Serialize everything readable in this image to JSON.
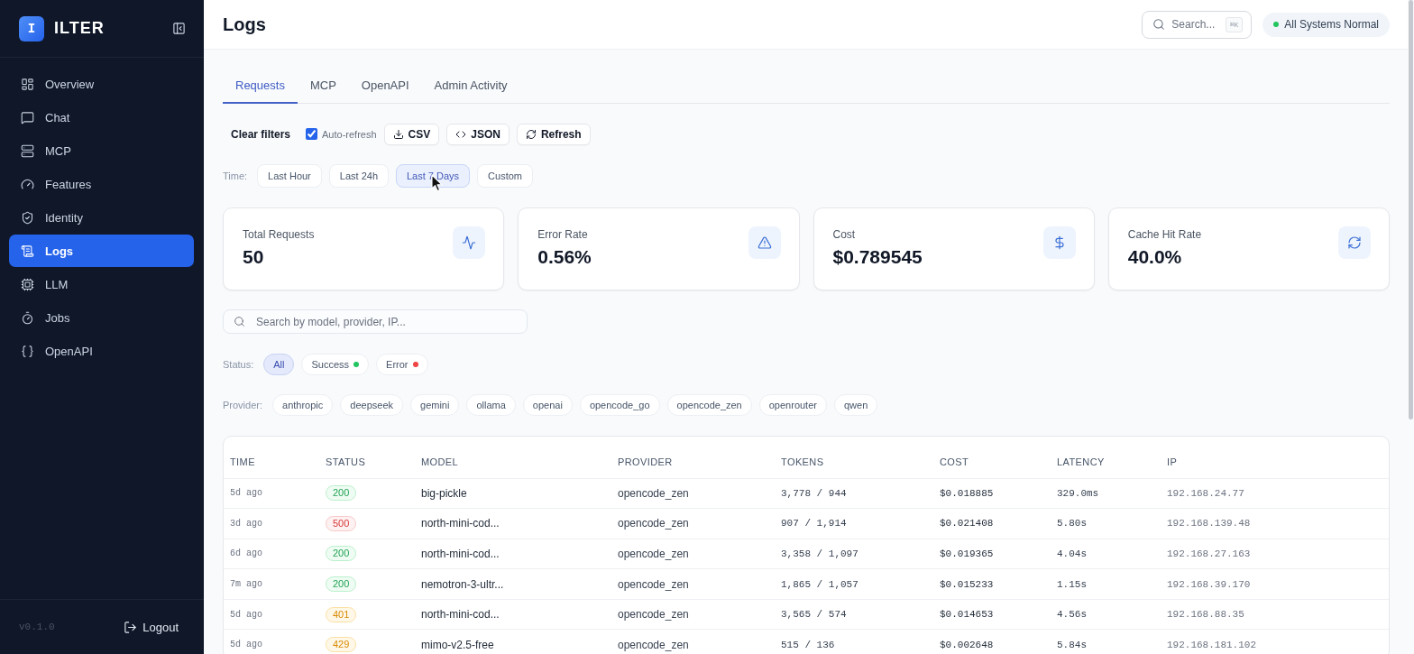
{
  "sidebar": {
    "logo": {
      "letter": "I",
      "name": "ILTER"
    },
    "items": [
      {
        "label": "Overview",
        "selected": false
      },
      {
        "label": "Chat",
        "selected": false
      },
      {
        "label": "MCP",
        "selected": false
      },
      {
        "label": "Features",
        "selected": false
      },
      {
        "label": "Identity",
        "selected": false
      },
      {
        "label": "Logs",
        "selected": true
      },
      {
        "label": "LLM",
        "selected": false
      },
      {
        "label": "Jobs",
        "selected": false
      },
      {
        "label": "OpenAPI",
        "selected": false
      }
    ],
    "version": "v0.1.0",
    "logout": "Logout"
  },
  "header": {
    "title": "Logs",
    "search": {
      "label": "Search...",
      "shortcut": "⌘K"
    },
    "status": "All Systems Normal"
  },
  "tabs": [
    {
      "label": "Requests",
      "selected": true
    },
    {
      "label": "MCP",
      "selected": false
    },
    {
      "label": "OpenAPI",
      "selected": false
    },
    {
      "label": "Admin Activity",
      "selected": false
    }
  ],
  "toolbar": {
    "clear": "Clear filters",
    "auto_refresh": {
      "label": "Auto-refresh",
      "checked": true
    },
    "buttons": [
      "CSV",
      "JSON",
      "Refresh"
    ]
  },
  "time_filter": {
    "label": "Time:",
    "options": [
      {
        "label": "Last Hour",
        "selected": false
      },
      {
        "label": "Last 24h",
        "selected": false
      },
      {
        "label": "Last 7 Days",
        "selected": true
      },
      {
        "label": "Custom",
        "selected": false
      }
    ]
  },
  "stats": [
    {
      "label": "Total Requests",
      "value": "50"
    },
    {
      "label": "Error Rate",
      "value": "0.56%"
    },
    {
      "label": "Cost",
      "value": "$0.789545"
    },
    {
      "label": "Cache Hit Rate",
      "value": "40.0%"
    }
  ],
  "search": {
    "placeholder": "Search by model, provider, IP..."
  },
  "status_filter": {
    "label": "Status:",
    "options": [
      {
        "label": "All",
        "selected": true
      },
      {
        "label": "Success",
        "selected": false,
        "color": "#22c55e"
      },
      {
        "label": "Error",
        "selected": false,
        "color": "#ef4444"
      }
    ]
  },
  "provider_filter": {
    "label": "Provider:",
    "options": [
      {
        "label": "anthropic",
        "selected": false
      },
      {
        "label": "deepseek",
        "selected": false
      },
      {
        "label": "gemini",
        "selected": false
      },
      {
        "label": "ollama",
        "selected": false
      },
      {
        "label": "openai",
        "selected": false
      },
      {
        "label": "opencode_go",
        "selected": false
      },
      {
        "label": "opencode_zen",
        "selected": false
      },
      {
        "label": "openrouter",
        "selected": false
      },
      {
        "label": "qwen",
        "selected": false
      }
    ]
  },
  "table": {
    "columns": [
      "TIME",
      "STATUS",
      "MODEL",
      "PROVIDER",
      "TOKENS",
      "COST",
      "LATENCY",
      "IP"
    ],
    "rows": [
      {
        "time": "5d ago",
        "status": {
          "code": "200",
          "kind": "success"
        },
        "model": "big-pickle",
        "provider": "opencode_zen",
        "tokens": "3,778 / 944",
        "cost": "$0.018885",
        "latency": "329.0ms",
        "ip": "192.168.24.77"
      },
      {
        "time": "3d ago",
        "status": {
          "code": "500",
          "kind": "error"
        },
        "model": "north-mini-cod...",
        "provider": "opencode_zen",
        "tokens": "907 / 1,914",
        "cost": "$0.021408",
        "latency": "5.80s",
        "ip": "192.168.139.48"
      },
      {
        "time": "6d ago",
        "status": {
          "code": "200",
          "kind": "success"
        },
        "model": "north-mini-cod...",
        "provider": "opencode_zen",
        "tokens": "3,358 / 1,097",
        "cost": "$0.019365",
        "latency": "4.04s",
        "ip": "192.168.27.163"
      },
      {
        "time": "7m ago",
        "status": {
          "code": "200",
          "kind": "success"
        },
        "model": "nemotron-3-ultr...",
        "provider": "opencode_zen",
        "tokens": "1,865 / 1,057",
        "cost": "$0.015233",
        "latency": "1.15s",
        "ip": "192.168.39.170"
      },
      {
        "time": "5d ago",
        "status": {
          "code": "401",
          "kind": "warning"
        },
        "model": "north-mini-cod...",
        "provider": "opencode_zen",
        "tokens": "3,565 / 574",
        "cost": "$0.014653",
        "latency": "4.56s",
        "ip": "192.168.88.35"
      },
      {
        "time": "5d ago",
        "status": {
          "code": "429",
          "kind": "warning"
        },
        "model": "mimo-v2.5-free",
        "provider": "opencode_zen",
        "tokens": "515 / 136",
        "cost": "$0.002648",
        "latency": "5.84s",
        "ip": "192.168.181.102"
      }
    ]
  }
}
